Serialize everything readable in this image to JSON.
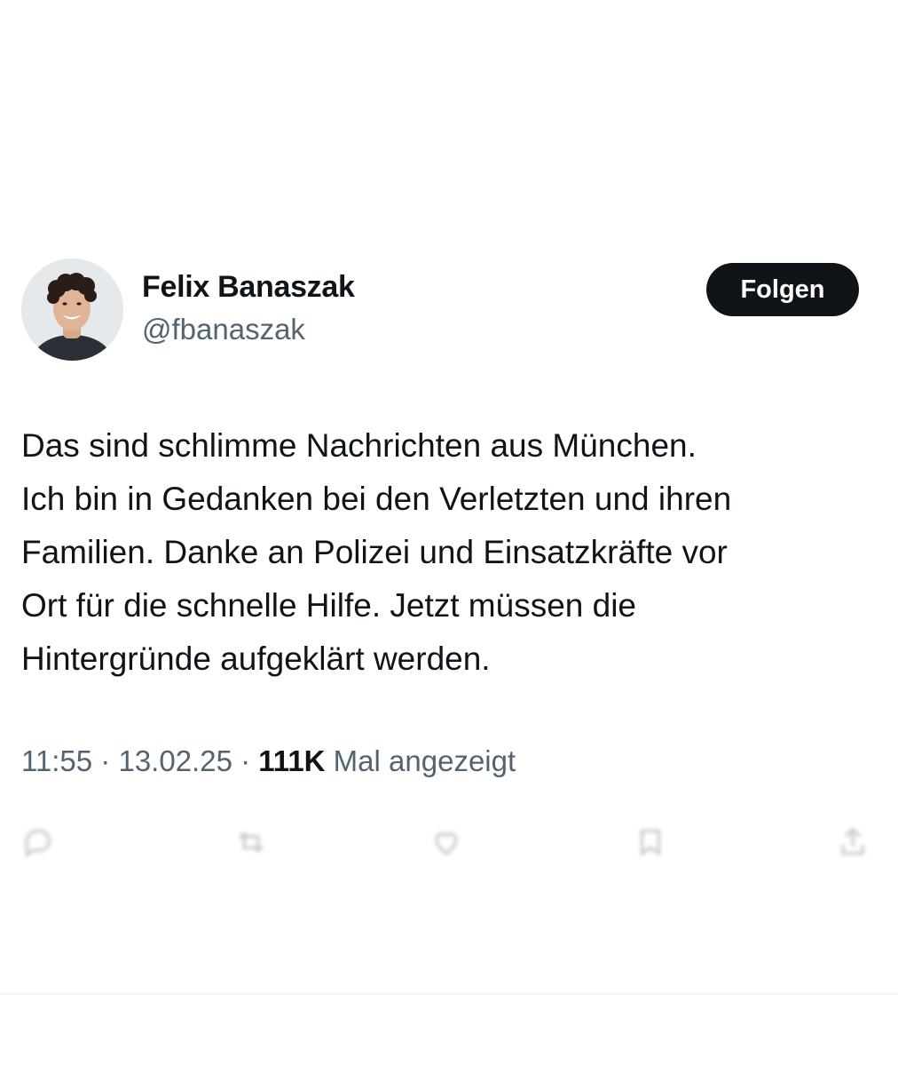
{
  "author": {
    "display_name": "Felix Banaszak",
    "handle": "@fbanaszak",
    "avatar_icon": "profile-photo"
  },
  "follow_button": {
    "label": "Folgen"
  },
  "tweet": {
    "lines": [
      "Das sind schlimme Nachrichten aus München.",
      "Ich bin in Gedanken bei den Verletzten und ihren",
      "Familien. Danke an Polizei und Einsatzkräfte vor",
      "Ort für die schnelle Hilfe. Jetzt müssen die",
      "Hintergründe aufgeklärt werden."
    ]
  },
  "meta": {
    "time": "11:55",
    "separator": " · ",
    "date": "13.02.25",
    "views_count": "111K",
    "views_label": " Mal angezeigt"
  },
  "actions": {
    "icons": [
      "reply-icon",
      "repost-icon",
      "like-icon",
      "bookmark-icon",
      "share-icon"
    ]
  },
  "colors": {
    "text_primary": "#0f1419",
    "text_secondary": "#536471",
    "button_bg": "#0f1419",
    "button_text": "#ffffff",
    "background": "#ffffff"
  }
}
